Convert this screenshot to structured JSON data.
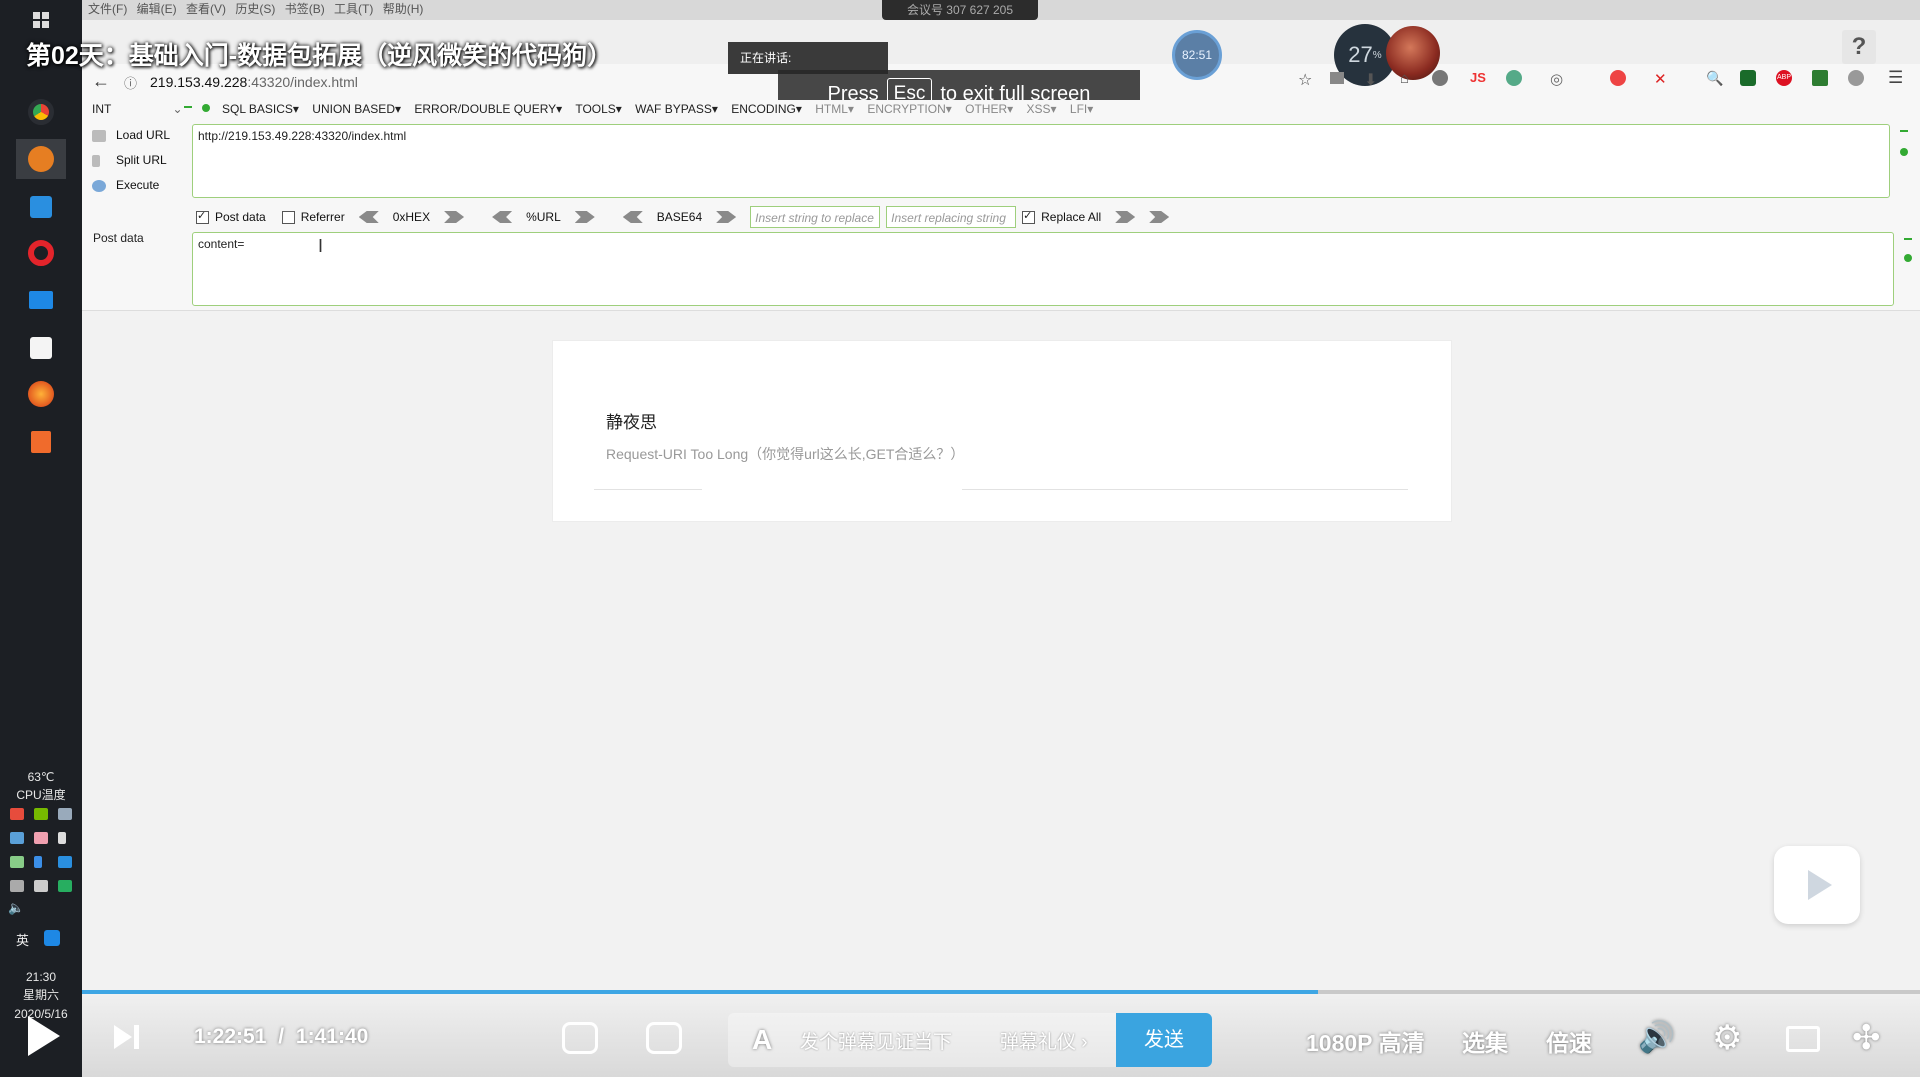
{
  "video": {
    "title": "第02天：基础入门-数据包拓展（逆风微笑的代码狗）",
    "current_time": "1:22:51",
    "separator": "/",
    "duration": "1:41:40",
    "progress_fraction": 0.6727,
    "timer_badge": "82:51",
    "stat_number": "27",
    "stat_unit": "%"
  },
  "overlays": {
    "talking": "正在讲话:",
    "meeting_id": "会议号 307 627 205",
    "fullscreen_press": "Press",
    "fullscreen_key": "Esc",
    "fullscreen_rest": "to exit full screen"
  },
  "browser": {
    "menu": [
      "文件(F)",
      "编辑(E)",
      "查看(V)",
      "历史(S)",
      "书签(B)",
      "工具(T)",
      "帮助(H)"
    ],
    "address_host": "219.153.49.228",
    "address_path": ":43320/index.html",
    "help": "?"
  },
  "hackbar": {
    "select": "INT",
    "menu": [
      "SQL BASICS▾",
      "UNION BASED▾",
      "ERROR/DOUBLE QUERY▾",
      "TOOLS▾",
      "WAF BYPASS▾",
      "ENCODING▾",
      "HTML▾",
      "ENCRYPTION▾",
      "OTHER▾",
      "XSS▾",
      "LFI▾"
    ],
    "load_url": "Load URL",
    "split_url": "Split URL",
    "execute": "Execute",
    "url_value": "http://219.153.49.228:43320/index.html",
    "post_data_check": "Post data",
    "referrer_check": "Referrer",
    "hex": "0xHEX",
    "url_enc": "%URL",
    "base64": "BASE64",
    "replace_placeholder": "Insert string to replace",
    "replacing_placeholder": "Insert replacing string",
    "replace_all": "Replace All",
    "post_label": "Post data",
    "post_value": "content="
  },
  "page": {
    "title": "静夜思",
    "message": "Request-URI Too Long（你觉得url这么长,GET合适么？）"
  },
  "taskbar": {
    "temp": "63℃",
    "temp_label": "CPU温度",
    "ime": "英",
    "time": "21:30",
    "weekday": "星期六",
    "date": "2020/5/16"
  },
  "player": {
    "danmaku_placeholder": "发个弹幕见证当下",
    "danmaku_etiquette": "弹幕礼仪 ›",
    "send": "发送",
    "quality": "1080P 高清",
    "episodes": "选集",
    "speed": "倍速"
  },
  "colors": {
    "progress": "#3ea6e4",
    "send_button": "#3aa4e0",
    "input_border": "#9ecf7c"
  }
}
